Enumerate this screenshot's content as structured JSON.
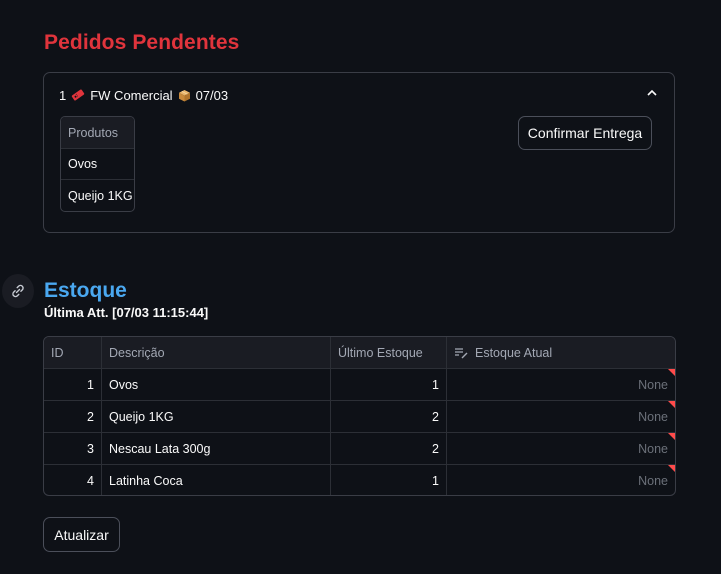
{
  "pedidos": {
    "title": "Pedidos Pendentes",
    "order": {
      "number": "1",
      "tag_icon": "ticket-icon",
      "client": "FW Comercial",
      "box_icon": "package-icon",
      "date": "07/03",
      "products_header": "Produtos",
      "products": [
        "Ovos",
        "Queijo 1KG"
      ],
      "confirm_label": "Confirmar Entrega"
    }
  },
  "estoque": {
    "title": "Estoque",
    "last_update": "Última Att. [07/03 11:15:44]",
    "columns": [
      "ID",
      "Descrição",
      "Último Estoque",
      "Estoque Atual"
    ],
    "rows": [
      {
        "id": "1",
        "desc": "Ovos",
        "ultimo": "1",
        "atual": "None"
      },
      {
        "id": "2",
        "desc": "Queijo 1KG",
        "ultimo": "2",
        "atual": "None"
      },
      {
        "id": "3",
        "desc": "Nescau Lata 300g",
        "ultimo": "2",
        "atual": "None"
      },
      {
        "id": "4",
        "desc": "Latinha Coca",
        "ultimo": "1",
        "atual": "None"
      }
    ],
    "update_label": "Atualizar"
  },
  "colors": {
    "background": "#0e1117",
    "pedidos_title": "#e0343c",
    "estoque_title": "#4aa8f0",
    "edited_flag": "#ff4b4b"
  }
}
